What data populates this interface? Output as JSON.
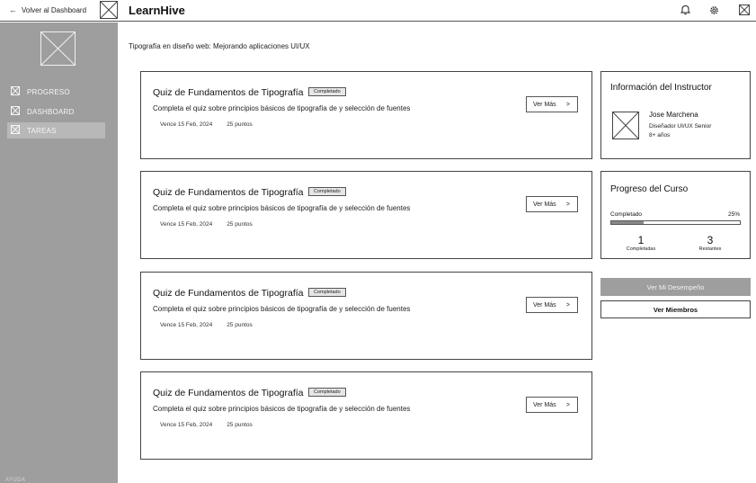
{
  "header": {
    "back_label": "Volver al Dashboard",
    "back_icon": "arrow-left-icon",
    "brand": "LearnHive",
    "icons": [
      "bell-icon",
      "gear-icon",
      "image-placeholder-icon"
    ]
  },
  "sidebar": {
    "items": [
      {
        "label": "PROGRESO",
        "icon": "checkbox-icon",
        "active": false
      },
      {
        "label": "DASHBOARD",
        "icon": "checkbox-icon",
        "active": false
      },
      {
        "label": "TAREAS",
        "icon": "checkbox-icon",
        "active": true
      }
    ],
    "help": "AYUDA"
  },
  "main": {
    "breadcrumb": "Tipografía en diseño web: Mejorando aplicaciones UI/UX",
    "tasks": [
      {
        "title": "Quiz de Fundamentos de Tipografía",
        "status": "Completado",
        "description": "Completa el quiz sobre principios básicos de tipografía de y selección de fuentes",
        "due": "Vence 15 Feb, 2024",
        "points": "25 puntos",
        "button": "Ver Más",
        "button_icon": ">"
      },
      {
        "title": "Quiz de Fundamentos de Tipografía",
        "status": "Completado",
        "description": "Completa el quiz sobre principios básicos de tipografía de y selección de fuentes",
        "due": "Vence 15 Feb, 2024",
        "points": "25 puntos",
        "button": "Ver Más",
        "button_icon": ">"
      },
      {
        "title": "Quiz de Fundamentos de Tipografía",
        "status": "Completado",
        "description": "Completa el quiz sobre principios básicos de tipografía de y selección de fuentes",
        "due": "Vence 15 Feb, 2024",
        "points": "25 puntos",
        "button": "Ver Más",
        "button_icon": ">"
      },
      {
        "title": "Quiz de Fundamentos de Tipografía",
        "status": "Completado",
        "description": "Completa el quiz sobre principios básicos de tipografía de y selección de fuentes",
        "due": "Vence 15 Feb, 2024",
        "points": "25 puntos",
        "button": "Ver Más",
        "button_icon": ">"
      }
    ]
  },
  "instructor": {
    "title": "Información del Instructor",
    "name": "Jose Marchena",
    "role": "Diseñador UI/UX Senior",
    "experience": "8+ años"
  },
  "progress": {
    "title": "Progreso del Curso",
    "label": "Completado",
    "percent_text": "25%",
    "percent": 25,
    "completed_count": "1",
    "completed_label": "Completadas",
    "remaining_count": "3",
    "remaining_label": "Restantes"
  },
  "actions": {
    "performance": "Ver Mi Desempeño",
    "members": "Ver Miembros"
  },
  "colors": {
    "sidebar_bg": "#9e9e9e",
    "border": "#444444",
    "progress_fill": "#888888"
  }
}
